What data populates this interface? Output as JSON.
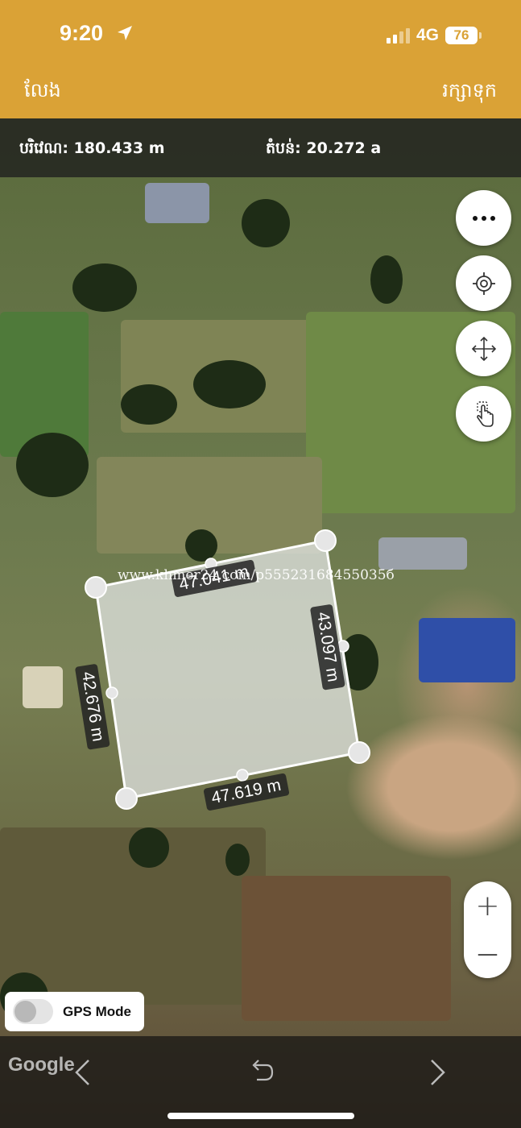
{
  "status_bar": {
    "time": "9:20",
    "network": "4G",
    "battery": "76"
  },
  "nav": {
    "left_label": "លែង",
    "right_label": "រក្សាទុក"
  },
  "info": {
    "perimeter": "បរិវេណ: 180.433 m",
    "area": "តំបន់: 20.272 a"
  },
  "polygon": {
    "labels": {
      "top": "47.041 m",
      "right": "43.097 m",
      "bottom": "47.619 m",
      "left": "42.676 m"
    }
  },
  "watermark": "www.khmer24.com/p55523168455035б",
  "controls": {
    "more_icon": "ellipsis-icon",
    "locate_icon": "crosshair-icon",
    "move_icon": "move-arrows-icon",
    "touch_icon": "hand-touch-icon",
    "zoom_in": "+",
    "zoom_out": "—"
  },
  "gps": {
    "label": "GPS Mode",
    "enabled": false
  },
  "footer": {
    "attribution": "Google"
  },
  "colors": {
    "accent": "#daa236",
    "polygon_fill": "#e8eaea",
    "polygon_stroke": "#ffffff"
  }
}
